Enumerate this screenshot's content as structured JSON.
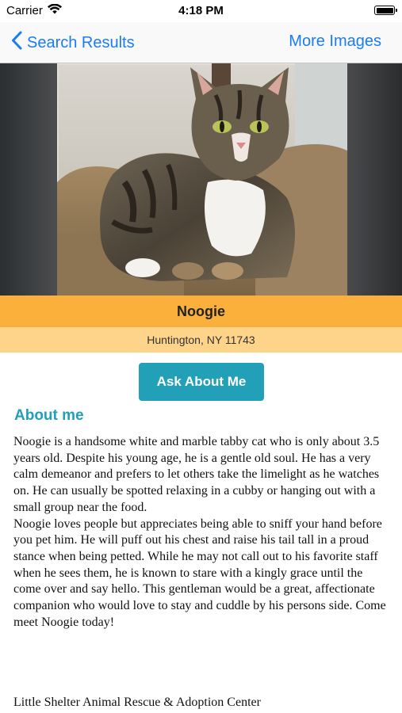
{
  "status_bar": {
    "carrier": "Carrier",
    "time": "4:18 PM",
    "wifi_icon": "wifi-icon",
    "battery_icon": "battery-icon"
  },
  "nav": {
    "back_label": "Search Results",
    "right_label": "More Images",
    "accent_color": "#1a7cf5"
  },
  "pet": {
    "photo_alt": "cat-photo",
    "name": "Noogie",
    "location": "Huntington, NY 11743"
  },
  "actions": {
    "ask_label": "Ask About Me",
    "button_color": "#22a0b7"
  },
  "about": {
    "heading": "About me",
    "paragraph_1": "Noogie is a handsome white and marble tabby cat who is only about 3.5 years old. Despite his young age, he is a gentle old soul. He has a very calm demeanor and prefers to let others take the limelight as he watches on. He can usually be spotted relaxing in a cubby or hanging out with a small group near the food.",
    "paragraph_2": "Noogie loves people but appreciates being able to sniff your hand before you pet him. He will puff out his chest and raise his tail tall in a proud stance when being petted. While he may not call out to his favorite staff when he sees them, he is known to stare with a kingly grace until the come over and say hello. This gentleman would be a great, affectionate companion who would love to stay and cuddle by his persons side. Come meet Noogie today!"
  },
  "shelter": {
    "name": "Little Shelter Animal Rescue & Adoption Center"
  },
  "colors": {
    "name_bar": "#fbb03b",
    "location_bar": "#fdd48a"
  }
}
